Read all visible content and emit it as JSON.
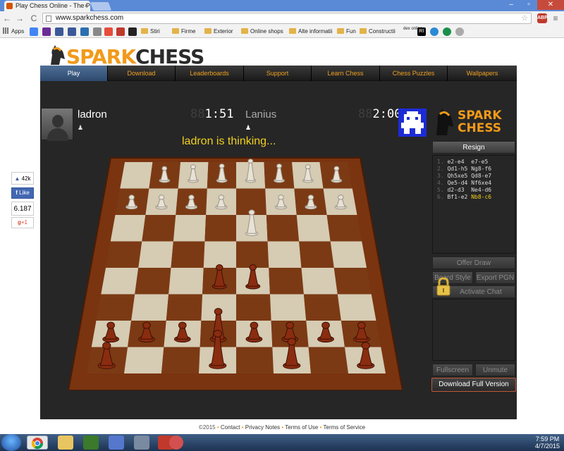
{
  "browser": {
    "tab_title": "Play Chess Online - The P",
    "tab_close": "×",
    "url": "www.sparkchess.com",
    "window_controls": [
      "–",
      "▫",
      "✕"
    ],
    "nav": {
      "back": "←",
      "forward": "→",
      "reload": "C"
    },
    "star": "☆",
    "extensions": [
      "ABP",
      "≡"
    ]
  },
  "bookmarks": {
    "apps_label": "Apps",
    "icons": [
      "g-icon",
      "y-icon",
      "f-icon",
      "f-icon",
      "t-icon",
      "m-icon",
      "rl-icon",
      "x-icon",
      "b-icon"
    ],
    "folders": [
      "Stiri",
      "Firme",
      "Exterior",
      "Online shops",
      "Alte informatii",
      "Fun",
      "Constructii"
    ],
    "trailing": [
      "dex online",
      "RI"
    ]
  },
  "site": {
    "logo_text_a": "SPARK",
    "logo_text_b": "CHESS",
    "nav": [
      "Play",
      "Download",
      "Leaderboards",
      "Support",
      "Learn Chess",
      "Chess Puzzles",
      "Wallpapers"
    ],
    "active_nav": "Play"
  },
  "game": {
    "player1": {
      "name": "ladron",
      "clock_dim": "88",
      "clock": "1:51",
      "piece": "♟"
    },
    "player2": {
      "name": "Lanius",
      "clock_dim": "88",
      "clock": "2:00",
      "piece": "♟"
    },
    "status": "ladron is thinking...",
    "brand_a": "SPARK",
    "brand_b": "CHESS",
    "resign": "Resign",
    "moves": [
      {
        "n": "1.",
        "w": "e2-e4",
        "b": "e7-e5"
      },
      {
        "n": "2.",
        "w": "Qd1-h5",
        "b": "Ng8-f6"
      },
      {
        "n": "3.",
        "w": "Qh5xe5",
        "b": "Qd8-e7"
      },
      {
        "n": "4.",
        "w": "Qe5-d4",
        "b": "Nf6xe4"
      },
      {
        "n": "5.",
        "w": "d2-d3",
        "b": "Ne4-d6"
      },
      {
        "n": "6.",
        "w": "Bf1-e2",
        "b": "Nb8-c6"
      }
    ],
    "offer_draw": "Offer Draw",
    "board_style": "Board Style",
    "export_pgn": "Export PGN",
    "activate_chat": "Activate Chat",
    "fullscreen": "Fullscreen",
    "unmute": "Unmute",
    "download_full": "Download Full Version"
  },
  "social": {
    "like_count": "42k",
    "like_label": "Like",
    "share_count": "6.187",
    "gplus_label": "+1"
  },
  "footer": {
    "copyright": "©2015",
    "links": [
      "Contact",
      "Privacy Notes",
      "Terms of Use",
      "Terms of Service"
    ]
  },
  "taskbar": {
    "time": "7:59 PM",
    "date": "4/7/2015"
  },
  "colors": {
    "accent": "#f29a1a",
    "status_yellow": "#f0d020",
    "nav_active": "#4f6f96"
  }
}
